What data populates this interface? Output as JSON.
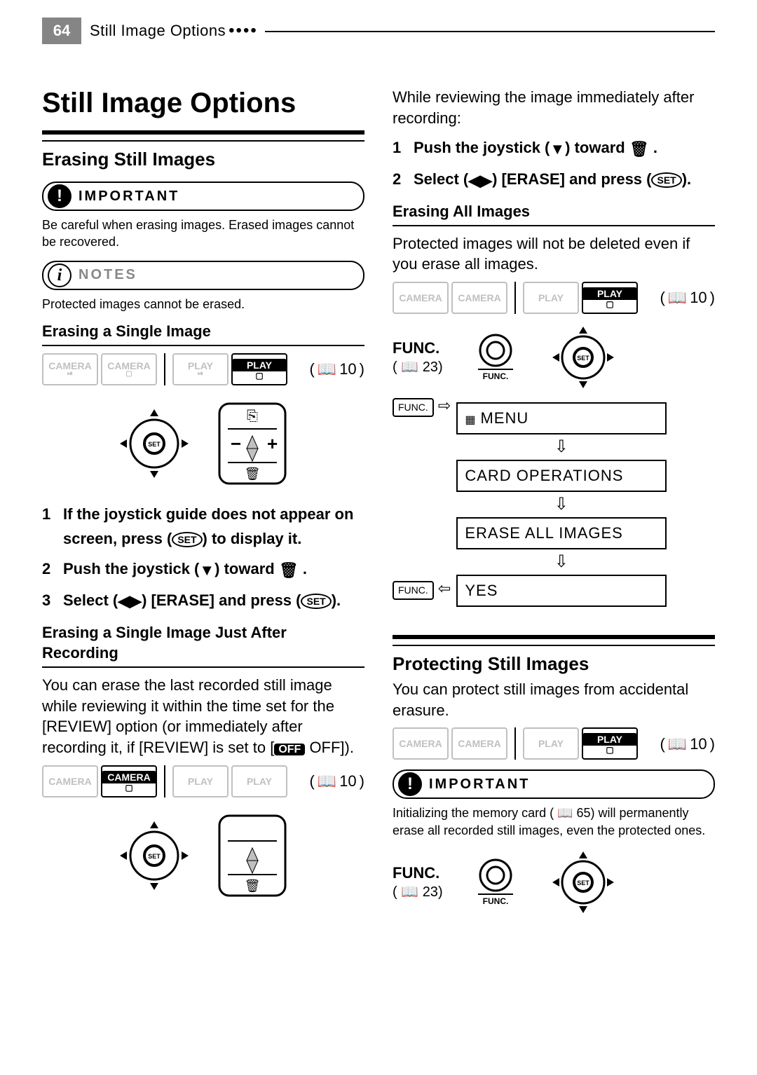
{
  "header": {
    "page_number": "64",
    "breadcrumb": "Still Image Options",
    "dots": "••••"
  },
  "title": "Still Image Options",
  "erasing": {
    "heading": "Erasing Still Images",
    "important_label": "IMPORTANT",
    "important_text": "Be careful when erasing images. Erased images cannot be recovered.",
    "notes_label": "NOTES",
    "notes_text": "Protected images cannot be erased."
  },
  "single": {
    "heading": "Erasing a Single Image",
    "ref": "10",
    "steps": {
      "s1": "If the joystick guide does not appear on screen, press (",
      "s1b": ") to display it.",
      "s2": "Push the joystick (",
      "s2b": ") toward ",
      "s2c": " .",
      "s3a": "Select (",
      "s3b": ") [ERASE] and press (",
      "s3c": ")."
    }
  },
  "after_rec": {
    "heading": "Erasing a Single Image Just After Recording",
    "text": "You can erase the last recorded still image while reviewing it within the time set for the [REVIEW] option (or immediately after recording it, if [REVIEW] is set to [",
    "text_b": " OFF]).",
    "ref": "10"
  },
  "right_intro": {
    "text": "While reviewing the image immediately after recording:",
    "s1a": "Push the joystick (",
    "s1b": ") toward ",
    "s1c": " .",
    "s2a": "Select (",
    "s2b": ") [ERASE] and press (",
    "s2c": ")."
  },
  "all": {
    "heading": "Erasing All Images",
    "text": "Protected images will not be deleted even if you erase all images.",
    "ref": "10",
    "func": "FUNC.",
    "func_ref": "23",
    "menu": {
      "m1": "MENU",
      "m2": "CARD OPERATIONS",
      "m3": "ERASE ALL IMAGES",
      "m4": "YES"
    },
    "func_badge": "FUNC."
  },
  "protect": {
    "heading": "Protecting Still Images",
    "text": "You can protect still images from accidental erasure.",
    "ref": "10",
    "important_label": "IMPORTANT",
    "important_text": "Initializing the memory card ( 📖 65) will permanently erase all recorded still images, even the protected ones.",
    "func": "FUNC.",
    "func_ref": "23"
  },
  "modes": {
    "camera_tape": "CAMERA",
    "camera_card": "CAMERA",
    "play_tape": "PLAY",
    "play_card": "PLAY"
  },
  "icons": {
    "set": "SET",
    "off": "OFF"
  }
}
